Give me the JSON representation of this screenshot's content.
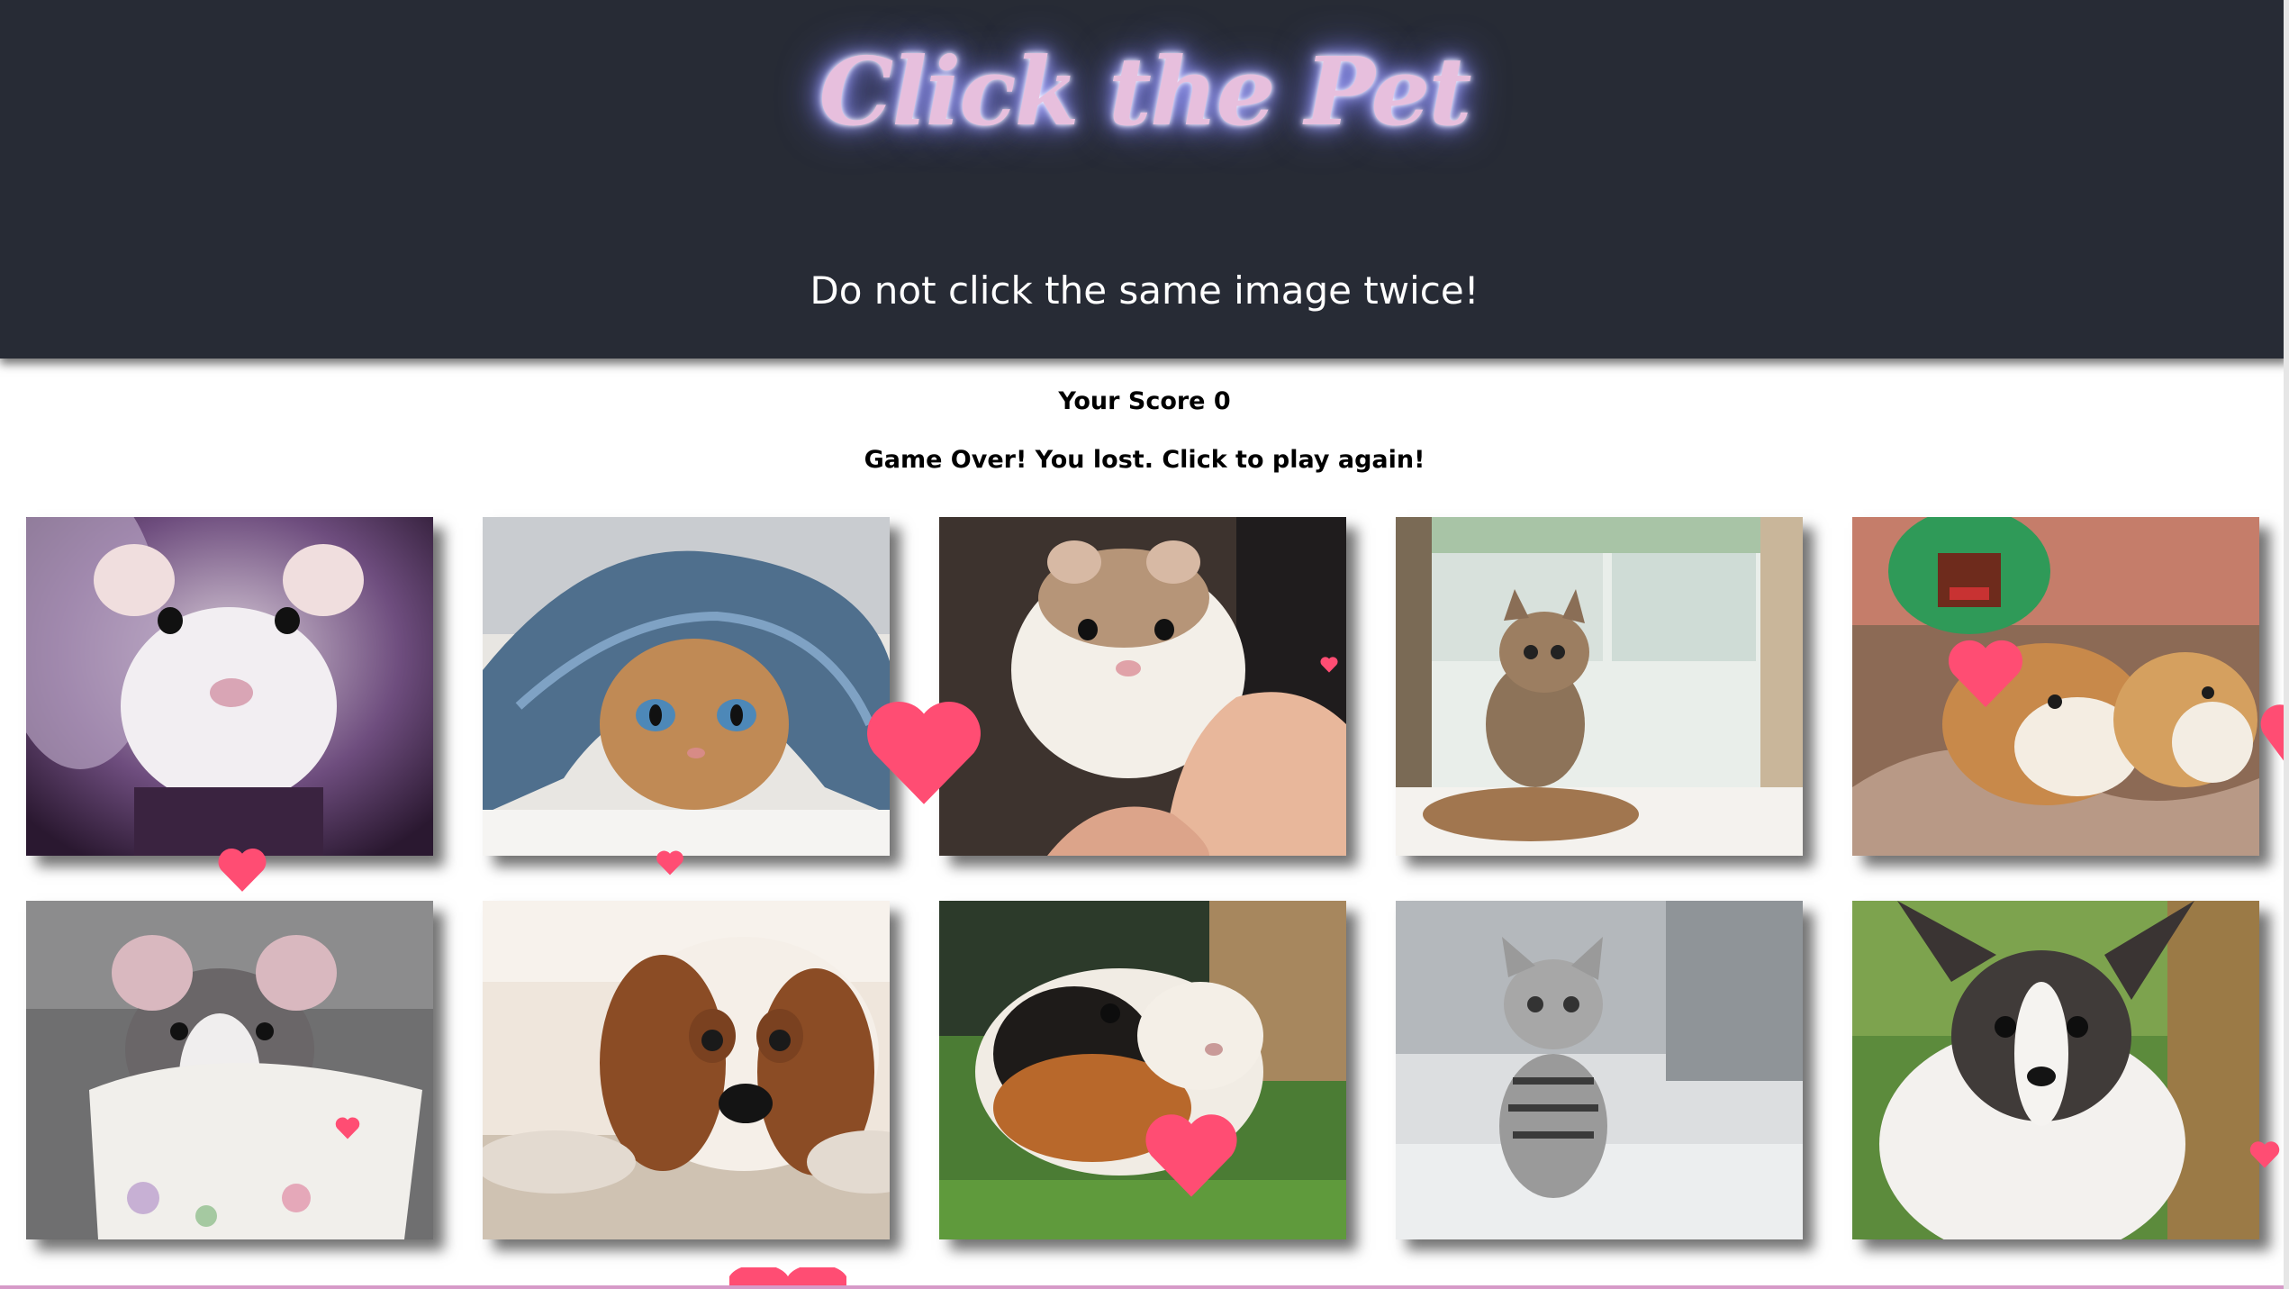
{
  "header": {
    "title": "Click the Pet",
    "subtitle": "Do not click the same image twice!"
  },
  "status": {
    "score_text": "Your Score 0",
    "message": "Game Over! You lost. Click to play again!"
  },
  "cards": [
    {
      "name": "card-white-rat",
      "subject": "white rat in purple blanket"
    },
    {
      "name": "card-kitten-denim",
      "subject": "kitten peeking from denim"
    },
    {
      "name": "card-hamster",
      "subject": "hamster in hand"
    },
    {
      "name": "card-tabby-kitten",
      "subject": "small tabby kitten"
    },
    {
      "name": "card-guinea-pigs",
      "subject": "guinea pigs with toy"
    },
    {
      "name": "card-rat-cup",
      "subject": "rat in teacup"
    },
    {
      "name": "card-spaniel",
      "subject": "spaniel puppy lying down"
    },
    {
      "name": "card-guinea-pig-grass",
      "subject": "guinea pig on grass"
    },
    {
      "name": "card-silver-kitten",
      "subject": "silver tabby kitten"
    },
    {
      "name": "card-chihuahua",
      "subject": "chihuahua puppy"
    }
  ],
  "colors": {
    "header_bg": "#272b35",
    "title": "#e7bfdd",
    "heart": "#ff4d73"
  }
}
